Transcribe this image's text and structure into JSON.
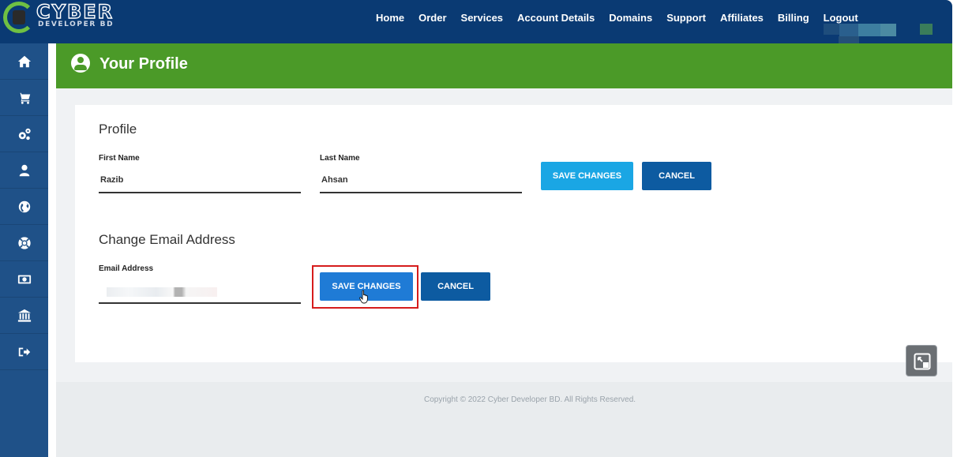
{
  "brand": {
    "name_main": "CYBER",
    "name_sub": "DEVELOPER BD"
  },
  "nav": {
    "items": [
      {
        "label": "Home"
      },
      {
        "label": "Order"
      },
      {
        "label": "Services"
      },
      {
        "label": "Account Details"
      },
      {
        "label": "Domains"
      },
      {
        "label": "Support"
      },
      {
        "label": "Affiliates"
      },
      {
        "label": "Billing"
      },
      {
        "label": "Logout"
      }
    ]
  },
  "sidebar": {
    "icons": [
      "home-icon",
      "cart-icon",
      "gears-icon",
      "user-icon",
      "globe-icon",
      "lifebuoy-icon",
      "money-icon",
      "bank-icon",
      "logout-icon"
    ]
  },
  "header": {
    "title": "Your Profile",
    "icon": "user-circle-icon"
  },
  "profile": {
    "title": "Profile",
    "first_name_label": "First Name",
    "first_name_value": "Razib",
    "last_name_label": "Last Name",
    "last_name_value": "Ahsan",
    "save_label": "SAVE CHANGES",
    "cancel_label": "CANCEL"
  },
  "email": {
    "title": "Change Email Address",
    "email_label": "Email Address",
    "save_label": "SAVE CHANGES",
    "cancel_label": "CANCEL"
  },
  "footer": {
    "copyright": "Copyright © 2022 Cyber Developer BD. All Rights Reserved."
  },
  "colors": {
    "topbar": "#0a3a73",
    "sidebar": "#1f5188",
    "header_green": "#4b9a28",
    "button_light": "#1aa6e4",
    "button_dark": "#0d5ba1",
    "highlight": "#d61c1c"
  }
}
